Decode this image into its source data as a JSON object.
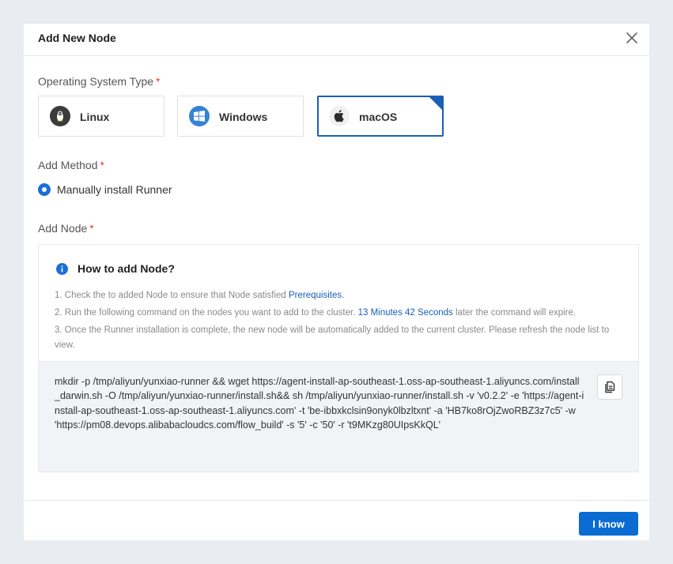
{
  "dialog": {
    "title": "Add New Node"
  },
  "os_type": {
    "label": "Operating System Type",
    "required_mark": "*",
    "options": [
      {
        "label": "Linux",
        "icon": "linux-icon"
      },
      {
        "label": "Windows",
        "icon": "windows-icon"
      },
      {
        "label": "macOS",
        "icon": "apple-icon",
        "selected": true
      }
    ]
  },
  "add_method": {
    "label": "Add Method",
    "required_mark": "*",
    "option": "Manually install Runner",
    "selected": true
  },
  "add_node": {
    "label": "Add Node",
    "required_mark": "*",
    "info_title": "How to add Node?",
    "step1_text": "1. Check the to added Node to ensure that Node satisfied ",
    "step1_link": "Prerequisites.",
    "step2_text_a": "2. Run the following command on the nodes you want to add to the cluster. ",
    "step2_timer": "13 Minutes 42 Seconds",
    "step2_text_b": " later the command will expire.",
    "step3_text": "3. Once the Runner installation is complete, the new node will be automatically added to the current cluster. Please refresh the node list to view.",
    "command": "mkdir -p /tmp/aliyun/yunxiao-runner && wget https://agent-install-ap-southeast-1.oss-ap-southeast-1.aliyuncs.com/install_darwin.sh -O /tmp/aliyun/yunxiao-runner/install.sh&& sh /tmp/aliyun/yunxiao-runner/install.sh -v 'v0.2.2' -e 'https://agent-install-ap-southeast-1.oss-ap-southeast-1.aliyuncs.com' -t 'be-ibbxkclsin9onyk0lbzltxnt' -a 'HB7ko8rOjZwoRBZ3z7c5' -w 'https://pm08.devops.alibabacloudcs.com/flow_build' -s '5' -c '50' -r 't9MKzg80UIpsKkQL'"
  },
  "footer": {
    "primary_label": "I know"
  },
  "colors": {
    "accent": "#1b5fb4",
    "primary_button": "#0a6bd2",
    "required": "#e23c39",
    "link": "#1b5fb4"
  }
}
